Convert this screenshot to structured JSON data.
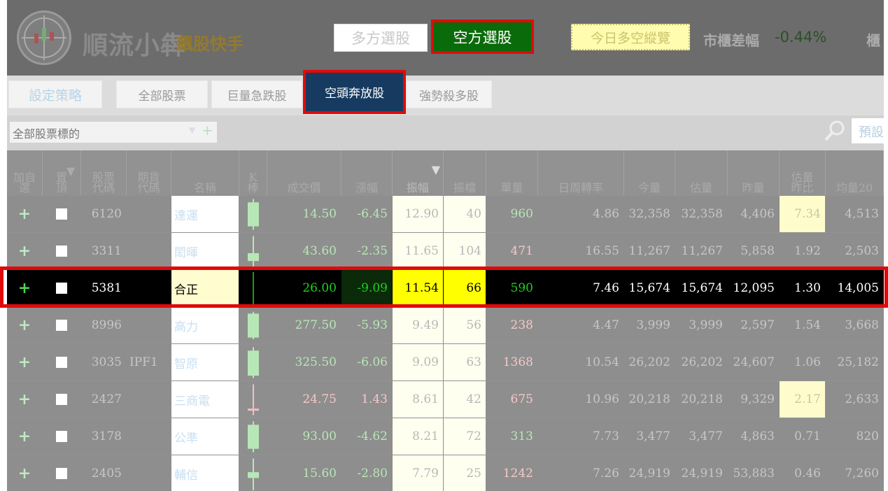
{
  "header": {
    "app_title": "順流小犇",
    "app_subtitle": "飆股快手",
    "bull_button": "多方選股",
    "bear_button": "空方選股",
    "overview_button": "今日多空縱覽",
    "market_label": "市櫃差幅",
    "market_value": "-0.44%",
    "market_label2": "櫃",
    "colors": {
      "bear_button_bg": "#0a6b0a",
      "highlight_border": "#e00a0a",
      "selected_tab_bg": "#173b60"
    }
  },
  "tabs": [
    {
      "label": "設定策略"
    },
    {
      "label": "全部股票"
    },
    {
      "label": "巨量急跌股"
    },
    {
      "label": "空頭奔放股",
      "selected": true
    },
    {
      "label": "強勢殺多股"
    }
  ],
  "filter": {
    "select_value": "全部股票標的",
    "preset_label": "預設"
  },
  "table": {
    "headers": [
      "加自選",
      "置頂",
      "股票代碼",
      "期貨代碼",
      "名稱",
      "K棒",
      "成交價",
      "漲幅",
      "振幅",
      "振檔",
      "單量",
      "日周轉率",
      "今量",
      "估量",
      "昨量",
      "估量昨比",
      "均量20"
    ],
    "header_lines": [
      [
        "加自",
        "選"
      ],
      [
        "置",
        "頂"
      ],
      [
        "股票",
        "代碼"
      ],
      [
        "期貨",
        "代碼"
      ],
      [
        "名稱"
      ],
      [
        "K",
        "棒"
      ],
      [
        "成交價"
      ],
      [
        "漲幅"
      ],
      [
        "振幅"
      ],
      [
        "振檔"
      ],
      [
        "單量"
      ],
      [
        "日周轉率"
      ],
      [
        "今量"
      ],
      [
        "估量"
      ],
      [
        "昨量"
      ],
      [
        "估量",
        "昨比"
      ],
      [
        "均量20"
      ]
    ],
    "sort_indicator": "▼",
    "rows": [
      {
        "add": "+",
        "code": "6120",
        "fut": "",
        "name": "達運",
        "price": "14.50",
        "change": "-6.45",
        "amp": "12.90",
        "amp_ticks": "40",
        "vol_single": "960",
        "turnover": "4.86",
        "vol_today": "32,358",
        "vol_est": "32,358",
        "vol_yday": "4,406",
        "est_ratio": "7.34",
        "avg20": "4,513",
        "change_dir": "down",
        "single_dir": "up",
        "ratio_hl": true,
        "k": {
          "up": true,
          "o": 0.15,
          "c": 0.85,
          "h": 0.05,
          "l": 0.95
        }
      },
      {
        "add": "+",
        "code": "3311",
        "fut": "",
        "name": "閎暉",
        "price": "43.60",
        "change": "-2.35",
        "amp": "11.65",
        "amp_ticks": "104",
        "vol_single": "471",
        "turnover": "16.55",
        "vol_today": "11,267",
        "vol_est": "11,267",
        "vol_yday": "5,858",
        "est_ratio": "1.92",
        "avg20": "2,503",
        "change_dir": "down",
        "single_dir": "down",
        "ratio_hl": false,
        "k": {
          "up": true,
          "o": 0.55,
          "c": 0.78,
          "h": 0.05,
          "l": 0.98
        }
      },
      {
        "add": "+",
        "code": "5381",
        "fut": "",
        "name": "合正",
        "price": "26.00",
        "change": "-9.09",
        "amp": "11.54",
        "amp_ticks": "66",
        "vol_single": "590",
        "turnover": "7.46",
        "vol_today": "15,674",
        "vol_est": "15,674",
        "vol_yday": "12,095",
        "est_ratio": "1.30",
        "avg20": "14,005",
        "change_dir": "down",
        "single_dir": "up",
        "ratio_hl": false,
        "k": {
          "up": false,
          "o": 0.96,
          "c": 0.98,
          "h": 0.02,
          "l": 0.98
        }
      },
      {
        "add": "+",
        "code": "8996",
        "fut": "",
        "name": "高力",
        "price": "277.50",
        "change": "-5.93",
        "amp": "9.49",
        "amp_ticks": "56",
        "vol_single": "238",
        "turnover": "4.47",
        "vol_today": "3,999",
        "vol_est": "3,999",
        "vol_yday": "2,597",
        "est_ratio": "1.54",
        "avg20": "3,668",
        "change_dir": "down",
        "single_dir": "down",
        "ratio_hl": false,
        "k": {
          "up": true,
          "o": 0.15,
          "c": 0.85,
          "h": 0.1,
          "l": 0.9
        }
      },
      {
        "add": "+",
        "code": "3035",
        "fut": "IPF1",
        "name": "智原",
        "price": "325.50",
        "change": "-6.06",
        "amp": "9.09",
        "amp_ticks": "63",
        "vol_single": "1368",
        "turnover": "10.54",
        "vol_today": "26,202",
        "vol_est": "26,202",
        "vol_yday": "24,607",
        "est_ratio": "1.06",
        "avg20": "25,182",
        "change_dir": "down",
        "single_dir": "down",
        "ratio_hl": false,
        "k": {
          "up": true,
          "o": 0.15,
          "c": 0.88,
          "h": 0.05,
          "l": 0.95
        }
      },
      {
        "add": "+",
        "code": "2427",
        "fut": "",
        "name": "三商電",
        "price": "24.75",
        "change": "1.43",
        "amp": "8.61",
        "amp_ticks": "42",
        "vol_single": "675",
        "turnover": "10.96",
        "vol_today": "20,218",
        "vol_est": "20,218",
        "vol_yday": "9,329",
        "est_ratio": "2.17",
        "avg20": "2,633",
        "change_dir": "up",
        "single_dir": "down",
        "ratio_hl": true,
        "k": {
          "up": false,
          "o": 0.76,
          "c": 0.82,
          "h": 0.05,
          "l": 0.95
        }
      },
      {
        "add": "+",
        "code": "3178",
        "fut": "",
        "name": "公準",
        "price": "93.00",
        "change": "-4.62",
        "amp": "8.21",
        "amp_ticks": "72",
        "vol_single": "313",
        "turnover": "7.73",
        "vol_today": "3,477",
        "vol_est": "3,477",
        "vol_yday": "4,863",
        "est_ratio": "0.71",
        "avg20": "820",
        "change_dir": "down",
        "single_dir": "up",
        "ratio_hl": false,
        "k": {
          "up": true,
          "o": 0.15,
          "c": 0.85,
          "h": 0.05,
          "l": 0.95
        }
      },
      {
        "add": "+",
        "code": "2405",
        "fut": "",
        "name": "輔信",
        "price": "15.60",
        "change": "-2.80",
        "amp": "7.79",
        "amp_ticks": "25",
        "vol_single": "1242",
        "turnover": "7.26",
        "vol_today": "24,919",
        "vol_est": "24,919",
        "vol_yday": "53,883",
        "est_ratio": "0.46",
        "avg20": "7,260",
        "change_dir": "down",
        "single_dir": "down",
        "ratio_hl": false,
        "k": {
          "up": true,
          "o": 0.45,
          "c": 0.62,
          "h": 0.05,
          "l": 0.98
        }
      }
    ],
    "selected_row": 2
  }
}
